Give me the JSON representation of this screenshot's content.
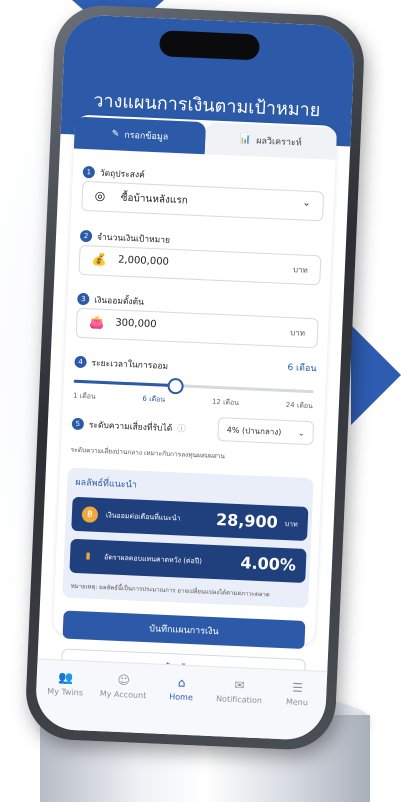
{
  "app": {
    "title": "วางแผนการเงินตามเป้าหมาย"
  },
  "tabs": [
    {
      "label": "กรอกข้อมูล",
      "active": true
    },
    {
      "label": "ผลวิเคราะห์",
      "active": false
    }
  ],
  "form": {
    "goal": {
      "label": "วัตถุประสงค์",
      "value": "ซื้อบ้านหลังแรก"
    },
    "target_amount": {
      "label": "จำนวนเงินเป้าหมาย",
      "value": "2,000,000",
      "unit": "บาท"
    },
    "initial_savings": {
      "label": "เงินออมตั้งต้น",
      "value": "300,000",
      "unit": "บาท"
    },
    "duration": {
      "label": "ระยะเวลาในการออม",
      "value": "6 เดือน",
      "ticks": [
        "1 เดือน",
        "6 เดือน",
        "12 เดือน",
        "24 เดือน"
      ],
      "level": 0.42
    },
    "risk": {
      "label": "ระดับความเสี่ยงที่รับได้",
      "value": "4% (ปานกลาง)",
      "note": "ระดับความเสี่ยงปานกลาง เหมาะกับการลงทุนผสมผสาน"
    }
  },
  "results": {
    "title": "ผลลัพธ์ที่แนะนำ",
    "monthly": {
      "label": "เงินออมต่อเดือนที่แนะนำ",
      "value": "28,900",
      "unit": "บาท"
    },
    "return": {
      "label": "อัตราผลตอบแทนคาดหวัง (ต่อปี)",
      "value": "4.00%"
    },
    "disclaimer": "หมายเหตุ: ผลลัพธ์นี้เป็นการประมาณการ อาจเปลี่ยนแปลงได้ตามสภาวะตลาด"
  },
  "buttons": {
    "save": "บันทึกแผนการเงิน",
    "clear": "ล้างข้อมูล"
  },
  "nav": [
    {
      "label": "My Twins",
      "active": false
    },
    {
      "label": "My Account",
      "active": false
    },
    {
      "label": "Home",
      "active": true
    },
    {
      "label": "Notification",
      "active": false
    },
    {
      "label": "Menu",
      "active": false
    }
  ],
  "colors": {
    "primary": "#2c5aa8",
    "dark": "#1f3f7d",
    "accent": "#f1a83a"
  }
}
